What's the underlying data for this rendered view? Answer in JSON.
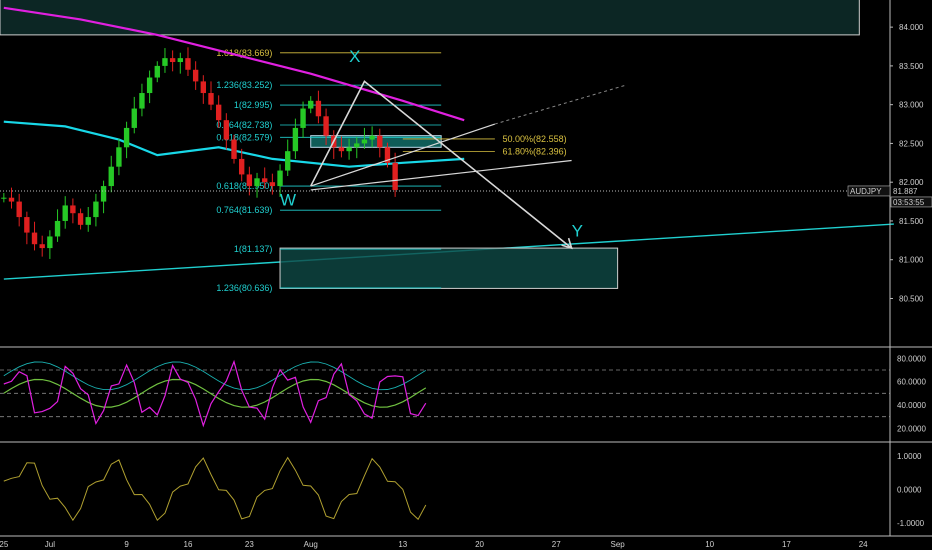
{
  "chart_data": [
    {
      "type": "candlestick",
      "title": "",
      "symbol": "AUDJPY",
      "last_price": "81.887",
      "countdown": "03:53:55",
      "colors": {
        "up": "#26c926",
        "down": "#e02020",
        "ema_short": "#e020e0",
        "ema_long": "#18d8e8",
        "fib": "#d8c040",
        "level": "#20d0d0"
      },
      "ylim": [
        79.9,
        84.35
      ],
      "price_ticks": [
        "84.000",
        "83.500",
        "83.000",
        "82.500",
        "82.000",
        "81.500",
        "81.000",
        "80.500"
      ],
      "date_ticks": [
        "25",
        "Jul",
        "9",
        "16",
        "23",
        "Aug",
        "13",
        "20",
        "27",
        "Sep",
        "10",
        "17",
        "24"
      ],
      "date_positions": [
        0,
        6,
        16,
        24,
        32,
        40,
        52,
        62,
        72,
        80,
        92,
        102,
        112
      ],
      "n_bars": 116,
      "candles_close": [
        81.8,
        81.75,
        81.55,
        81.35,
        81.2,
        81.15,
        81.3,
        81.5,
        81.7,
        81.6,
        81.45,
        81.55,
        81.75,
        81.95,
        82.2,
        82.45,
        82.7,
        82.95,
        83.15,
        83.35,
        83.5,
        83.6,
        83.55,
        83.6,
        83.45,
        83.3,
        83.15,
        83.0,
        82.8,
        82.55,
        82.3,
        82.1,
        81.95,
        82.05,
        82.0,
        81.95,
        82.15,
        82.4,
        82.7,
        82.95,
        83.05,
        82.85,
        82.6,
        82.45,
        82.4,
        82.45,
        82.5,
        82.55,
        82.6,
        82.45,
        82.25,
        81.9
      ],
      "candles_open_offset": 0,
      "ema_short": [
        [
          0,
          84.25
        ],
        [
          10,
          84.1
        ],
        [
          20,
          83.9
        ],
        [
          30,
          83.65
        ],
        [
          40,
          83.4
        ],
        [
          52,
          83.05
        ],
        [
          60,
          82.8
        ]
      ],
      "ema_long": [
        [
          0,
          82.78
        ],
        [
          8,
          82.72
        ],
        [
          15,
          82.55
        ],
        [
          20,
          82.35
        ],
        [
          28,
          82.45
        ],
        [
          35,
          82.3
        ],
        [
          45,
          82.2
        ],
        [
          52,
          82.25
        ],
        [
          60,
          82.3
        ]
      ],
      "trend_line": [
        [
          0,
          80.75
        ],
        [
          116,
          81.46
        ]
      ],
      "fib_levels": [
        {
          "label": "1.618(83.669)",
          "price": 83.669,
          "color": "#d8c040"
        },
        {
          "label": "1.236(83.252)",
          "price": 83.252,
          "color": "#20d0d0"
        },
        {
          "label": "1(82.995)",
          "price": 82.995,
          "color": "#20d0d0"
        },
        {
          "label": "0.764(82.738)",
          "price": 82.738,
          "color": "#20d0d0"
        },
        {
          "label": "0.618(82.579)",
          "price": 82.579,
          "color": "#20d0d0"
        },
        {
          "label": "0.618(81.950)",
          "price": 81.95,
          "color": "#20d0d0"
        },
        {
          "label": "0.764(81.639)",
          "price": 81.639,
          "color": "#20d0d0"
        },
        {
          "label": "1(81.137)",
          "price": 81.137,
          "color": "#20d0d0"
        },
        {
          "label": "1.236(80.636)",
          "price": 80.636,
          "color": "#20d0d0"
        },
        {
          "label": "50.00%(82.558)",
          "price": 82.558,
          "color": "#d8c040"
        },
        {
          "label": "61.80%(82.396)",
          "price": 82.396,
          "color": "#d8c040"
        }
      ],
      "wave_labels": [
        {
          "label": "W",
          "bar": 36,
          "price": 81.7
        },
        {
          "label": "X",
          "bar": 45,
          "price": 83.55
        },
        {
          "label": "Y",
          "bar": 74,
          "price": 81.3
        }
      ],
      "target_box": {
        "from_bar": 36,
        "to_bar": 80,
        "high": 81.15,
        "low": 80.63
      },
      "reversal_box": {
        "from_bar": 40,
        "to_bar": 57,
        "high": 82.6,
        "low": 82.45
      },
      "top_box": {
        "from_bar": 0,
        "to_bar": 112,
        "high": 84.5,
        "low": 83.9
      }
    },
    {
      "type": "line",
      "name": "oscillator",
      "ylim": [
        10,
        88
      ],
      "ticks": [
        "80.0000",
        "60.0000",
        "40.0000",
        "20.0000"
      ],
      "tick_values": [
        80,
        60,
        40,
        20
      ],
      "levels": [
        70,
        50,
        30
      ]
    },
    {
      "type": "line",
      "name": "momentum",
      "ylim": [
        -1.35,
        1.35
      ],
      "ticks": [
        "1.0000",
        "0.0000",
        "-1.0000"
      ],
      "tick_values": [
        1,
        0,
        -1
      ]
    }
  ]
}
